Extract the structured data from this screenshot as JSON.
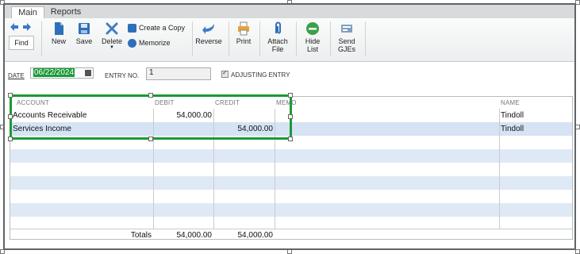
{
  "tabs": [
    {
      "label": "Main",
      "active": true
    },
    {
      "label": "Reports",
      "active": false
    }
  ],
  "toolbar": {
    "find_label": "Find",
    "new_label": "New",
    "save_label": "Save",
    "delete_label": "Delete",
    "create_copy_label": "Create a Copy",
    "memorize_label": "Memorize",
    "reverse_label": "Reverse",
    "print_label": "Print",
    "attach_label_1": "Attach",
    "attach_label_2": "File",
    "hide_label_1": "Hide",
    "hide_label_2": "List",
    "send_label_1": "Send",
    "send_label_2": "GJEs"
  },
  "form": {
    "date_label": "DATE",
    "date_value": "06/22/2024",
    "entry_no_label": "ENTRY NO.",
    "entry_no_value": "1",
    "adjusting_label": "ADJUSTING ENTRY",
    "adjusting_checked": true
  },
  "grid": {
    "headers": {
      "account": "ACCOUNT",
      "debit": "DEBIT",
      "credit": "CREDIT",
      "memo": "MEMO",
      "name": "NAME"
    },
    "rows": [
      {
        "account": "Accounts Receivable",
        "debit": "54,000.00",
        "credit": "",
        "memo": "",
        "name": "Tindoll"
      },
      {
        "account": "Services Income",
        "debit": "",
        "credit": "54,000.00",
        "memo": "",
        "name": "Tindoll"
      }
    ],
    "totals_label": "Totals",
    "total_debit": "54,000.00",
    "total_credit": "54,000.00"
  },
  "colors": {
    "selection_green": "#1b9a37",
    "row_stripe": "#dfe9f6",
    "selected_row": "#d5e3f4"
  }
}
